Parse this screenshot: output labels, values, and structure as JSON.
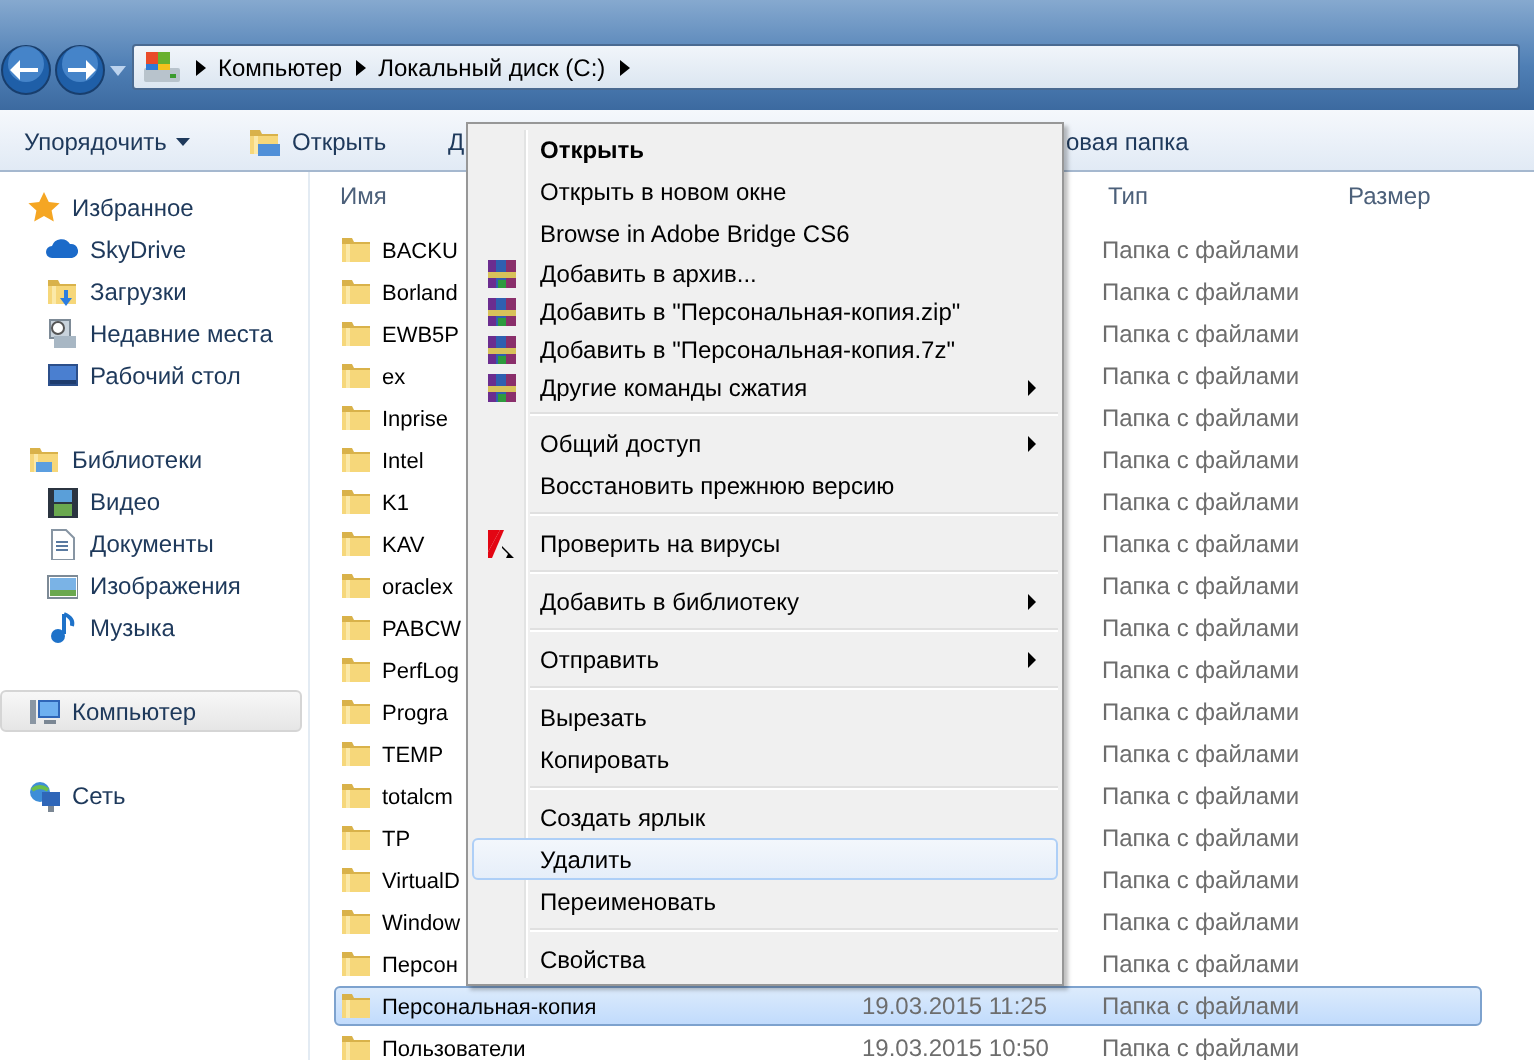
{
  "navigation": {
    "breadcrumbs": [
      "Компьютер",
      "Локальный диск (C:)"
    ]
  },
  "toolbar": [
    {
      "label": "Упорядочить",
      "kind": "dropdown"
    },
    {
      "label": "Открыть",
      "kind": "icon"
    },
    {
      "label": "Д",
      "kind": "plain"
    },
    {
      "label": "овая папка",
      "kind": "plain"
    }
  ],
  "sidebar": {
    "sections": [
      {
        "label": "Избранное",
        "selected": false,
        "items": [
          {
            "label": "SkyDrive",
            "selected": false
          },
          {
            "label": "Загрузки",
            "selected": false
          },
          {
            "label": "Недавние места",
            "selected": false
          },
          {
            "label": "Рабочий стол",
            "selected": false
          }
        ]
      },
      {
        "label": "Библиотеки",
        "selected": false,
        "items": [
          {
            "label": "Видео",
            "selected": false
          },
          {
            "label": "Документы",
            "selected": false
          },
          {
            "label": "Изображения",
            "selected": false
          },
          {
            "label": "Музыка",
            "selected": false
          }
        ]
      },
      {
        "label": "Компьютер",
        "selected": true
      },
      {
        "label": "Сеть",
        "selected": false
      }
    ]
  },
  "file_list": {
    "columns": [
      "Имя",
      "Тип",
      "Размер"
    ],
    "rows": [
      {
        "name": "BACKU",
        "type": "Папка с файлами",
        "selected": false
      },
      {
        "name": "Borland",
        "type": "Папка с файлами",
        "selected": false
      },
      {
        "name": "EWB5P",
        "type": "Папка с файлами",
        "selected": false
      },
      {
        "name": "ex",
        "type": "Папка с файлами",
        "selected": false
      },
      {
        "name": "Inprise",
        "type": "Папка с файлами",
        "selected": false
      },
      {
        "name": "Intel",
        "type": "Папка с файлами",
        "selected": false
      },
      {
        "name": "K1",
        "type": "Папка с файлами",
        "selected": false
      },
      {
        "name": "KAV",
        "type": "Папка с файлами",
        "selected": false
      },
      {
        "name": "oraclex",
        "type": "Папка с файлами",
        "selected": false
      },
      {
        "name": "PABCW",
        "type": "Папка с файлами",
        "selected": false
      },
      {
        "name": "PerfLog",
        "type": "Папка с файлами",
        "selected": false
      },
      {
        "name": "Progra",
        "type": "Папка с файлами",
        "selected": false
      },
      {
        "name": "TEMP",
        "type": "Папка с файлами",
        "selected": false
      },
      {
        "name": "totalcm",
        "type": "Папка с файлами",
        "selected": false
      },
      {
        "name": "TP",
        "type": "Папка с файлами",
        "selected": false
      },
      {
        "name": "VirtualD",
        "type": "Папка с файлами",
        "selected": false
      },
      {
        "name": "Window",
        "type": "Папка с файлами",
        "selected": false
      },
      {
        "name": "Персон",
        "type": "Папка с файлами",
        "selected": false
      },
      {
        "name": "Персональная-копия",
        "date": "19.03.2015 11:25",
        "type": "Папка с файлами",
        "selected": true
      },
      {
        "name": "Пользователи",
        "date": "19.03.2015 10:50",
        "type": "Папка с файлами",
        "selected": false
      }
    ]
  },
  "context_menu": {
    "items": [
      {
        "kind": "item",
        "label": "Открыть",
        "default": true,
        "submenu": false,
        "selected": false
      },
      {
        "kind": "item",
        "label": "Открыть в новом окне",
        "default": false,
        "submenu": false,
        "selected": false
      },
      {
        "kind": "item",
        "label": "Browse in Adobe Bridge CS6",
        "default": false,
        "submenu": false,
        "selected": false
      },
      {
        "kind": "archive",
        "label": "Добавить в архив...",
        "default": false,
        "submenu": false,
        "selected": false
      },
      {
        "kind": "archive",
        "label": "Добавить в \"Персональная-копия.zip\"",
        "default": false,
        "submenu": false,
        "selected": false
      },
      {
        "kind": "archive",
        "label": "Добавить в \"Персональная-копия.7z\"",
        "default": false,
        "submenu": false,
        "selected": false
      },
      {
        "kind": "archive",
        "label": "Другие команды сжатия",
        "default": false,
        "submenu": true,
        "selected": false
      },
      {
        "kind": "separator"
      },
      {
        "kind": "item",
        "label": "Общий доступ",
        "default": false,
        "submenu": true,
        "selected": false
      },
      {
        "kind": "item",
        "label": "Восстановить прежнюю версию",
        "default": false,
        "submenu": false,
        "selected": false
      },
      {
        "kind": "separator"
      },
      {
        "kind": "scan",
        "label": "Проверить на вирусы",
        "default": false,
        "submenu": false,
        "selected": false
      },
      {
        "kind": "separator"
      },
      {
        "kind": "item",
        "label": "Добавить в библиотеку",
        "default": false,
        "submenu": true,
        "selected": false
      },
      {
        "kind": "separator"
      },
      {
        "kind": "item",
        "label": "Отправить",
        "default": false,
        "submenu": true,
        "selected": false
      },
      {
        "kind": "separator"
      },
      {
        "kind": "item",
        "label": "Вырезать",
        "default": false,
        "submenu": false,
        "selected": false
      },
      {
        "kind": "item",
        "label": "Копировать",
        "default": false,
        "submenu": false,
        "selected": false
      },
      {
        "kind": "separator"
      },
      {
        "kind": "item",
        "label": "Создать ярлык",
        "default": false,
        "submenu": false,
        "selected": false
      },
      {
        "kind": "item",
        "label": "Удалить",
        "default": false,
        "submenu": false,
        "selected": true
      },
      {
        "kind": "item",
        "label": "Переименовать",
        "default": false,
        "submenu": false,
        "selected": false
      },
      {
        "kind": "separator"
      },
      {
        "kind": "item",
        "label": "Свойства",
        "default": false,
        "submenu": false,
        "selected": false
      }
    ]
  }
}
